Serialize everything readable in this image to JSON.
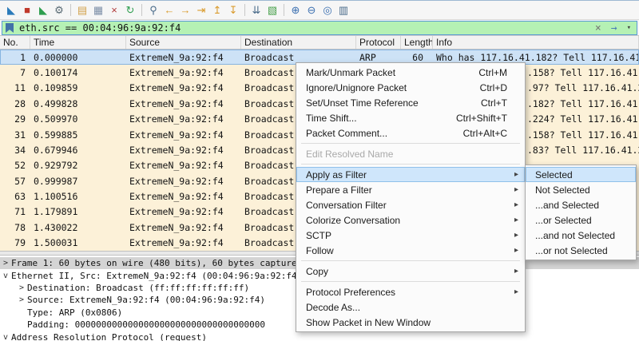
{
  "colors": {
    "filter_valid_bg": "#b5f1b4",
    "arp_row_bg": "#fcf1d8",
    "selected_row_bg": "#cde2f6",
    "menu_highlight_bg": "#cfe6fb",
    "detail_selected_bg": "#d4d4d4"
  },
  "toolbar": {
    "items": [
      {
        "name": "start-capture-button",
        "icon": "shark-fin-icon",
        "glyph": "◣",
        "color": "#2b7bba"
      },
      {
        "name": "stop-capture-button",
        "icon": "stop-icon",
        "glyph": "■",
        "color": "#c0392b"
      },
      {
        "name": "restart-capture-button",
        "icon": "restart-icon",
        "glyph": "◣",
        "color": "#2e9e4f"
      },
      {
        "name": "capture-options-button",
        "icon": "gear-icon",
        "glyph": "⚙",
        "color": "#5a6b75"
      },
      {
        "sep": true
      },
      {
        "name": "open-file-button",
        "icon": "open-folder-icon",
        "glyph": "▤",
        "color": "#d2a24c"
      },
      {
        "name": "save-file-button",
        "icon": "save-icon",
        "glyph": "▦",
        "color": "#7d8fa8"
      },
      {
        "name": "close-file-button",
        "icon": "close-icon",
        "glyph": "×",
        "color": "#b03a3a"
      },
      {
        "name": "reload-file-button",
        "icon": "reload-icon",
        "glyph": "↻",
        "color": "#2e9e4f"
      },
      {
        "sep": true
      },
      {
        "name": "find-packet-button",
        "icon": "magnifier-icon",
        "glyph": "⚲",
        "color": "#4a6b8a"
      },
      {
        "name": "go-back-button",
        "icon": "back-arrow-icon",
        "glyph": "←",
        "color": "#d99a2b"
      },
      {
        "name": "go-forward-button",
        "icon": "forward-arrow-icon",
        "glyph": "→",
        "color": "#d99a2b"
      },
      {
        "name": "go-to-packet-button",
        "icon": "goto-packet-icon",
        "glyph": "⇥",
        "color": "#d99a2b"
      },
      {
        "name": "go-to-first-button",
        "icon": "first-packet-icon",
        "glyph": "↥",
        "color": "#d99a2b"
      },
      {
        "name": "go-to-last-button",
        "icon": "last-packet-icon",
        "glyph": "↧",
        "color": "#d99a2b"
      },
      {
        "sep": true
      },
      {
        "name": "autoscroll-button",
        "icon": "autoscroll-icon",
        "glyph": "⇊",
        "color": "#4a6b8a"
      },
      {
        "name": "colorize-button",
        "icon": "colorize-icon",
        "glyph": "▧",
        "color": "#49a14d"
      },
      {
        "sep": true
      },
      {
        "name": "zoom-in-button",
        "icon": "zoom-in-icon",
        "glyph": "⊕",
        "color": "#3a6fb0"
      },
      {
        "name": "zoom-out-button",
        "icon": "zoom-out-icon",
        "glyph": "⊖",
        "color": "#3a6fb0"
      },
      {
        "name": "zoom-reset-button",
        "icon": "zoom-reset-icon",
        "glyph": "◎",
        "color": "#3a6fb0"
      },
      {
        "name": "resize-columns-button",
        "icon": "resize-columns-icon",
        "glyph": "▥",
        "color": "#4a6b8a"
      }
    ]
  },
  "filter": {
    "value": "eth.src == 00:04:96:9a:92:f4"
  },
  "packet_list": {
    "columns": [
      "No.",
      "Time",
      "Source",
      "Destination",
      "Protocol",
      "Length",
      "Info"
    ],
    "rows": [
      {
        "no": "1",
        "time": "0.000000",
        "source": "ExtremeN_9a:92:f4",
        "destination": "Broadcast",
        "protocol": "ARP",
        "length": "60",
        "info": "Who has 117.16.41.182? Tell 117.16.41.",
        "selected": true
      },
      {
        "no": "7",
        "time": "0.100174",
        "source": "ExtremeN_9a:92:f4",
        "destination": "Broadcast",
        "info_fragment": ".158? Tell 117.16.41."
      },
      {
        "no": "11",
        "time": "0.109859",
        "source": "ExtremeN_9a:92:f4",
        "destination": "Broadcast",
        "info_fragment": ".97? Tell 117.16.41.2"
      },
      {
        "no": "28",
        "time": "0.499828",
        "source": "ExtremeN_9a:92:f4",
        "destination": "Broadcast",
        "info_fragment": ".182? Tell 117.16.41."
      },
      {
        "no": "29",
        "time": "0.509970",
        "source": "ExtremeN_9a:92:f4",
        "destination": "Broadcast",
        "info_fragment": ".224? Tell 117.16.41."
      },
      {
        "no": "31",
        "time": "0.599885",
        "source": "ExtremeN_9a:92:f4",
        "destination": "Broadcast",
        "info_fragment": ".158? Tell 117.16.41."
      },
      {
        "no": "34",
        "time": "0.679946",
        "source": "ExtremeN_9a:92:f4",
        "destination": "Broadcast",
        "info_fragment": ".83? Tell 117.16.41.2"
      },
      {
        "no": "52",
        "time": "0.929792",
        "source": "ExtremeN_9a:92:f4",
        "destination": "Broadcast",
        "info_fragment": ""
      },
      {
        "no": "57",
        "time": "0.999987",
        "source": "ExtremeN_9a:92:f4",
        "destination": "Broadcast",
        "info_fragment": ""
      },
      {
        "no": "63",
        "time": "1.100516",
        "source": "ExtremeN_9a:92:f4",
        "destination": "Broadcast",
        "info_fragment": ""
      },
      {
        "no": "71",
        "time": "1.179891",
        "source": "ExtremeN_9a:92:f4",
        "destination": "Broadcast",
        "info_fragment": ""
      },
      {
        "no": "78",
        "time": "1.430022",
        "source": "ExtremeN_9a:92:f4",
        "destination": "Broadcast",
        "info_fragment": ""
      },
      {
        "no": "79",
        "time": "1.500031",
        "source": "ExtremeN_9a:92:f4",
        "destination": "Broadcast",
        "info_fragment": ""
      }
    ]
  },
  "context_menu": {
    "items": [
      {
        "label": "Mark/Unmark Packet",
        "shortcut": "Ctrl+M"
      },
      {
        "label": "Ignore/Unignore Packet",
        "shortcut": "Ctrl+D"
      },
      {
        "label": "Set/Unset Time Reference",
        "shortcut": "Ctrl+T"
      },
      {
        "label": "Time Shift...",
        "shortcut": "Ctrl+Shift+T"
      },
      {
        "label": "Packet Comment...",
        "shortcut": "Ctrl+Alt+C"
      },
      {
        "sep": true
      },
      {
        "label": "Edit Resolved Name",
        "disabled": true
      },
      {
        "sep": true
      },
      {
        "label": "Apply as Filter",
        "submenu": true,
        "highlighted": true
      },
      {
        "label": "Prepare a Filter",
        "submenu": true
      },
      {
        "label": "Conversation Filter",
        "submenu": true
      },
      {
        "label": "Colorize Conversation",
        "submenu": true
      },
      {
        "label": "SCTP",
        "submenu": true
      },
      {
        "label": "Follow",
        "submenu": true
      },
      {
        "sep": true
      },
      {
        "label": "Copy",
        "submenu": true
      },
      {
        "sep": true
      },
      {
        "label": "Protocol Preferences",
        "submenu": true
      },
      {
        "label": "Decode As..."
      },
      {
        "label": "Show Packet in New Window"
      }
    ]
  },
  "submenu": {
    "items": [
      {
        "label": "Selected",
        "highlighted": true
      },
      {
        "label": "Not Selected"
      },
      {
        "label": "...and Selected"
      },
      {
        "label": "...or Selected"
      },
      {
        "label": "...and not Selected"
      },
      {
        "label": "...or not Selected"
      }
    ]
  },
  "detail_pane": {
    "lines": [
      {
        "expander": ">",
        "text": "Frame 1: 60 bytes on wire (480 bits), 60 bytes captured (48",
        "selected": true,
        "indent": 0
      },
      {
        "expander": "v",
        "text": "Ethernet II, Src: ExtremeN_9a:92:f4 (00:04:96:9a:92:f4), D",
        "indent": 0
      },
      {
        "expander": ">",
        "text": "Destination: Broadcast (ff:ff:ff:ff:ff:ff)",
        "indent": 1
      },
      {
        "expander": ">",
        "text": "Source: ExtremeN_9a:92:f4 (00:04:96:9a:92:f4)",
        "indent": 1
      },
      {
        "expander": "",
        "text": "Type: ARP (0x0806)",
        "indent": 1
      },
      {
        "expander": "",
        "text": "Padding: 000000000000000000000000000000000000",
        "indent": 1
      },
      {
        "expander": "v",
        "text": "Address Resolution Protocol (request)",
        "indent": 0
      }
    ]
  }
}
